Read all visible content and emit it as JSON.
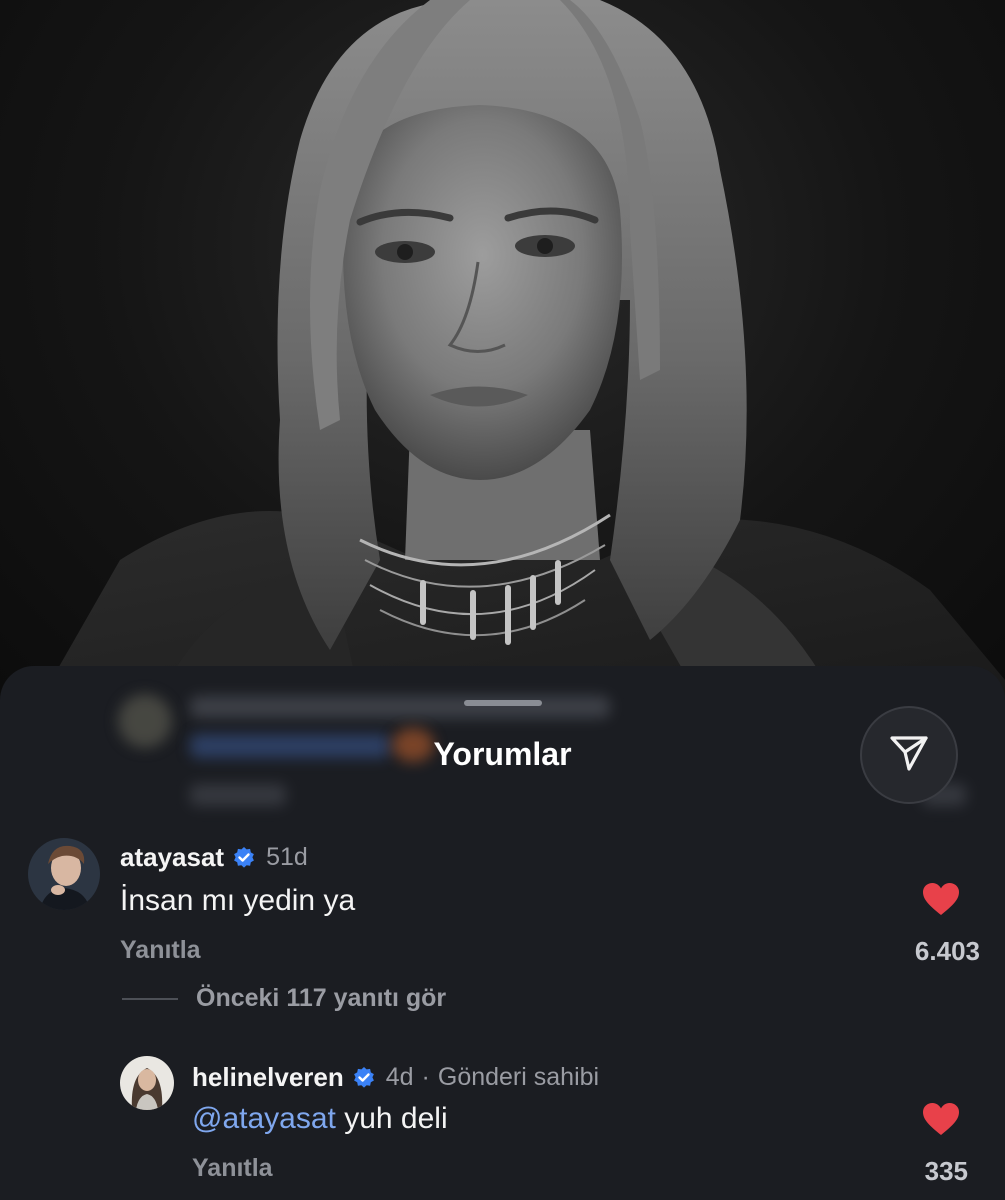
{
  "sheet": {
    "title": "Yorumlar",
    "send_icon": "send-icon",
    "grabber_icon": "grabber-handle"
  },
  "comments": [
    {
      "username": "atayasat",
      "verified": true,
      "time": "51d",
      "text": "İnsan mı yedin ya",
      "reply_label": "Yanıtla",
      "likes": "6.403",
      "liked": true
    }
  ],
  "view_replies": "Önceki 117 yanıtı gör",
  "replies": [
    {
      "username": "helinelveren",
      "verified": true,
      "time": "4d",
      "separator": "·",
      "owner_label": "Gönderi sahibi",
      "mention": "@atayasat",
      "text": " yuh deli",
      "reply_label": "Yanıtla",
      "likes": "335",
      "liked": true
    }
  ],
  "colors": {
    "sheet_bg": "#1b1d22",
    "heart": "#e8414a",
    "verified": "#3b82f6",
    "mention": "#7fa7ee"
  }
}
